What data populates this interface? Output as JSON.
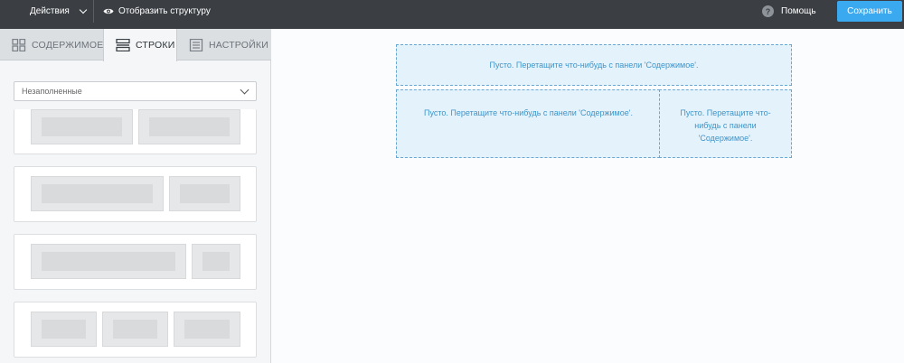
{
  "topbar": {
    "actions_label": "Действия",
    "structure_label": "Отобразить структуру",
    "help_label": "Помощь",
    "help_icon_glyph": "?",
    "save_label": "Сохранить"
  },
  "sidebar": {
    "tabs": [
      {
        "label": "СОДЕРЖИМОЕ",
        "icon": "grid-icon"
      },
      {
        "label": "СТРОКИ",
        "icon": "rows-icon"
      },
      {
        "label": "НАСТРОЙКИ",
        "icon": "settings-icon"
      }
    ],
    "active_tab": "СТРОКИ",
    "filter": {
      "selected": "Незаполненные"
    },
    "row_layouts": [
      "1:1",
      "2:1",
      "3:1",
      "1:1:1"
    ]
  },
  "canvas": {
    "empty_message": "Пусто. Перетащите что-нибудь с панели 'Содержимое'.",
    "empty_message_wrapped": "Пусто. Перетащите что-\nнибудь с панели\n'Содержимое'."
  },
  "colors": {
    "topbar": "#3b3f44",
    "save_button": "#3ba9ef",
    "drop_zone_bg": "#e3f2fb",
    "drop_zone_border": "#6aa8d4",
    "drop_zone_text": "#3f95c9"
  }
}
